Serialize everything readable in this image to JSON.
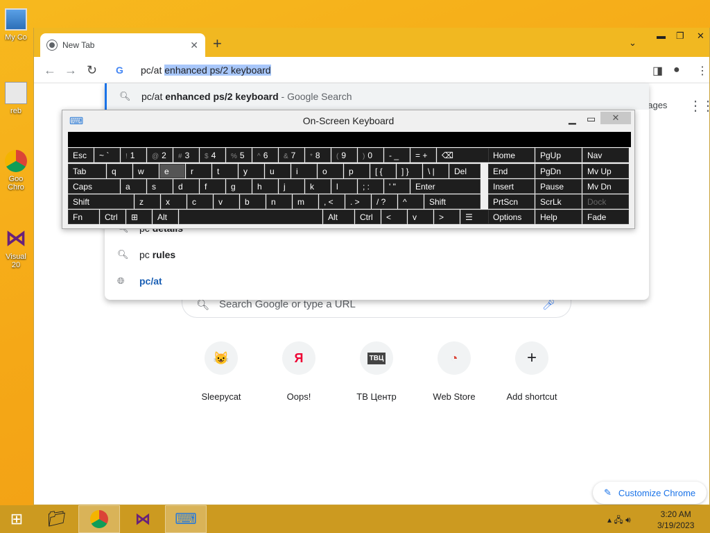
{
  "desktop": {
    "icons": [
      {
        "label": "My Co",
        "icon": "computer-icon"
      },
      {
        "label": "reb",
        "icon": "recycle-bin-icon"
      },
      {
        "label": "Goo",
        "label2": "Chro",
        "icon": "chrome-icon"
      },
      {
        "label": "Visual",
        "label2": "20",
        "icon": "visual-studio-icon"
      }
    ]
  },
  "browser": {
    "tab_title": "New Tab",
    "omnibox": {
      "typed": "pc/at ",
      "selected": "enhanced ps/2 keyboard"
    },
    "suggestions": [
      {
        "prefix": "pc/at ",
        "bold": "enhanced ps/2 keyboard",
        "suffix": " - Google Search",
        "icon": "search-icon"
      },
      {
        "prefix": "pc ",
        "bold": "details",
        "icon": "search-icon"
      },
      {
        "prefix": "pc ",
        "bold": "rules",
        "icon": "search-icon"
      },
      {
        "text": "pc/at",
        "icon": "globe-icon"
      }
    ],
    "images_link": "nages",
    "search_placeholder": "Search Google or type a URL",
    "shortcuts": [
      {
        "label": "Sleepycat",
        "glyph": "😺"
      },
      {
        "label": "Oops!",
        "glyph": "Я"
      },
      {
        "label": "ТВ Центр",
        "glyph": "ТВЦ"
      },
      {
        "label": "Web Store",
        "glyph": "◔"
      },
      {
        "label": "Add shortcut",
        "glyph": "+"
      }
    ],
    "customize_label": "Customize Chrome"
  },
  "osk": {
    "title": "On-Screen Keyboard",
    "rows": [
      [
        {
          "k": "Esc"
        },
        {
          "k": "~ `"
        },
        {
          "k": "1",
          "s": "!"
        },
        {
          "k": "2",
          "s": "@"
        },
        {
          "k": "3",
          "s": "#"
        },
        {
          "k": "4",
          "s": "$"
        },
        {
          "k": "5",
          "s": "%"
        },
        {
          "k": "6",
          "s": "^"
        },
        {
          "k": "7",
          "s": "&"
        },
        {
          "k": "8",
          "s": "*"
        },
        {
          "k": "9",
          "s": "("
        },
        {
          "k": "0",
          "s": ")"
        },
        {
          "k": "- _"
        },
        {
          "k": "= +"
        },
        {
          "k": "⌫"
        }
      ],
      [
        {
          "k": "Tab"
        },
        {
          "k": "q"
        },
        {
          "k": "w"
        },
        {
          "k": "e"
        },
        {
          "k": "r"
        },
        {
          "k": "t"
        },
        {
          "k": "y"
        },
        {
          "k": "u"
        },
        {
          "k": "i"
        },
        {
          "k": "o"
        },
        {
          "k": "p"
        },
        {
          "k": "[ {"
        },
        {
          "k": "] }"
        },
        {
          "k": "\\ |"
        },
        {
          "k": "Del"
        }
      ],
      [
        {
          "k": "Caps"
        },
        {
          "k": "a"
        },
        {
          "k": "s"
        },
        {
          "k": "d"
        },
        {
          "k": "f"
        },
        {
          "k": "g"
        },
        {
          "k": "h"
        },
        {
          "k": "j"
        },
        {
          "k": "k"
        },
        {
          "k": "l"
        },
        {
          "k": "; :"
        },
        {
          "k": "' \""
        },
        {
          "k": "Enter"
        }
      ],
      [
        {
          "k": "Shift"
        },
        {
          "k": "z"
        },
        {
          "k": "x"
        },
        {
          "k": "c"
        },
        {
          "k": "v"
        },
        {
          "k": "b"
        },
        {
          "k": "n"
        },
        {
          "k": "m"
        },
        {
          "k": ", <"
        },
        {
          "k": ". >"
        },
        {
          "k": "/ ?"
        },
        {
          "k": "^"
        },
        {
          "k": "Shift"
        }
      ],
      [
        {
          "k": "Fn"
        },
        {
          "k": "Ctrl"
        },
        {
          "k": "⊞"
        },
        {
          "k": "Alt"
        },
        {
          "k": ""
        },
        {
          "k": "Alt"
        },
        {
          "k": "Ctrl"
        },
        {
          "k": "<"
        },
        {
          "k": "v"
        },
        {
          "k": ">"
        },
        {
          "k": "☰"
        }
      ]
    ],
    "nav": [
      [
        "Home",
        "PgUp",
        "Nav"
      ],
      [
        "End",
        "PgDn",
        "Mv Up"
      ],
      [
        "Insert",
        "Pause",
        "Mv Dn"
      ],
      [
        "PrtScn",
        "ScrLk",
        "Dock"
      ],
      [
        "Options",
        "Help",
        "Fade"
      ]
    ]
  },
  "taskbar": {
    "time": "3:20 AM",
    "date": "3/19/2023"
  }
}
